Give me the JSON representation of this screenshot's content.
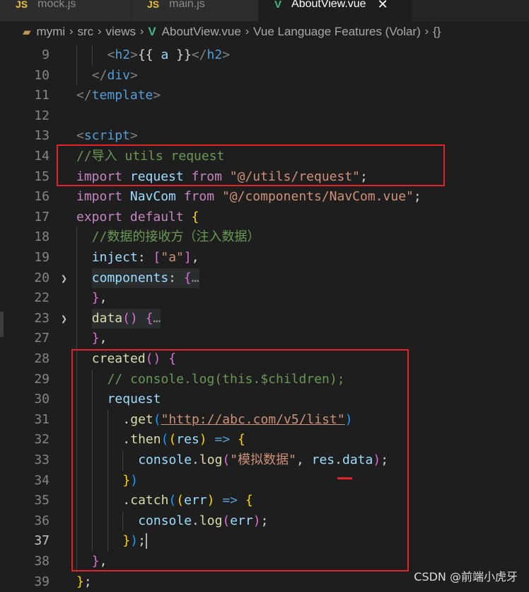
{
  "tabs": [
    {
      "icon": "JS",
      "label": "mock.js",
      "active": false
    },
    {
      "icon": "JS",
      "label": "main.js",
      "active": false
    },
    {
      "icon": "V",
      "label": "AboutView.vue",
      "active": true,
      "close": "✕"
    }
  ],
  "breadcrumb": {
    "items": [
      "mymi",
      "src",
      "views",
      "AboutView.vue",
      "Vue Language Features (Volar)",
      "{}"
    ],
    "sep": "›"
  },
  "lines": [
    {
      "n": "9",
      "tokens": [
        [
          "tag-pun",
          "<"
        ],
        [
          "tag",
          "h2"
        ],
        [
          "tag-pun",
          ">"
        ],
        [
          "text",
          "{{ "
        ],
        [
          "prop",
          "a"
        ],
        [
          "text",
          " }}"
        ],
        [
          "tag-pun",
          "</"
        ],
        [
          "tag",
          "h2"
        ],
        [
          "tag-pun",
          ">"
        ]
      ]
    },
    {
      "n": "10",
      "tokens": [
        [
          "tag-pun",
          "</"
        ],
        [
          "tag",
          "div"
        ],
        [
          "tag-pun",
          ">"
        ]
      ]
    },
    {
      "n": "11",
      "tokens": [
        [
          "tag-pun",
          "</"
        ],
        [
          "tag",
          "template"
        ],
        [
          "tag-pun",
          ">"
        ]
      ]
    },
    {
      "n": "12",
      "tokens": []
    },
    {
      "n": "13",
      "tokens": [
        [
          "tag-pun",
          "<"
        ],
        [
          "tag",
          "script"
        ],
        [
          "tag-pun",
          ">"
        ]
      ]
    },
    {
      "n": "14",
      "tokens": [
        [
          "cmt",
          "//导入 utils request"
        ]
      ]
    },
    {
      "n": "15",
      "tokens": [
        [
          "kw",
          "import"
        ],
        [
          "text",
          " "
        ],
        [
          "prop",
          "request"
        ],
        [
          "text",
          " "
        ],
        [
          "kw",
          "from"
        ],
        [
          "text",
          " "
        ],
        [
          "str",
          "\"@/utils/request\""
        ],
        [
          "text",
          ";"
        ]
      ]
    },
    {
      "n": "16",
      "tokens": [
        [
          "kw",
          "import"
        ],
        [
          "text",
          " "
        ],
        [
          "prop",
          "NavCom"
        ],
        [
          "text",
          " "
        ],
        [
          "kw",
          "from"
        ],
        [
          "text",
          " "
        ],
        [
          "str",
          "\"@/components/NavCom.vue\""
        ],
        [
          "text",
          ";"
        ]
      ]
    },
    {
      "n": "17",
      "tokens": [
        [
          "kw",
          "export"
        ],
        [
          "text",
          " "
        ],
        [
          "kw",
          "default"
        ],
        [
          "text",
          " "
        ],
        [
          "br1",
          "{"
        ]
      ]
    },
    {
      "n": "18",
      "tokens": [
        [
          "cmt",
          "//数据的接收方（注入数据）"
        ]
      ]
    },
    {
      "n": "19",
      "tokens": [
        [
          "prop",
          "inject"
        ],
        [
          "text",
          ": "
        ],
        [
          "br2",
          "["
        ],
        [
          "str",
          "\"a\""
        ],
        [
          "br2",
          "]"
        ],
        [
          "text",
          ","
        ]
      ]
    },
    {
      "n": "20",
      "tokens": [
        [
          "prop",
          "components"
        ],
        [
          "text",
          ": "
        ],
        [
          "br2",
          "{"
        ],
        [
          "ell",
          "…"
        ]
      ]
    },
    {
      "n": "22",
      "tokens": [
        [
          "br2",
          "}"
        ],
        [
          "text",
          ","
        ]
      ]
    },
    {
      "n": "23",
      "tokens": [
        [
          "fn",
          "data"
        ],
        [
          "br2",
          "()"
        ],
        [
          "text",
          " "
        ],
        [
          "br2",
          "{"
        ],
        [
          "ell",
          "…"
        ]
      ]
    },
    {
      "n": "27",
      "tokens": [
        [
          "br2",
          "}"
        ],
        [
          "text",
          ","
        ]
      ]
    },
    {
      "n": "28",
      "tokens": [
        [
          "fn",
          "created"
        ],
        [
          "br2",
          "()"
        ],
        [
          "text",
          " "
        ],
        [
          "br2",
          "{"
        ]
      ]
    },
    {
      "n": "29",
      "tokens": [
        [
          "cmt",
          "// console.log(this.$children);"
        ]
      ]
    },
    {
      "n": "30",
      "tokens": [
        [
          "prop",
          "request"
        ]
      ]
    },
    {
      "n": "31",
      "tokens": [
        [
          "text",
          "."
        ],
        [
          "fn",
          "get"
        ],
        [
          "br3",
          "("
        ],
        [
          "str-ul",
          "\"http://abc.com/v5/list\""
        ],
        [
          "br3",
          ")"
        ]
      ]
    },
    {
      "n": "32",
      "tokens": [
        [
          "text",
          "."
        ],
        [
          "fn",
          "then"
        ],
        [
          "br3",
          "("
        ],
        [
          "br1",
          "("
        ],
        [
          "prop",
          "res"
        ],
        [
          "br1",
          ")"
        ],
        [
          "text",
          " "
        ],
        [
          "tag",
          "=>"
        ],
        [
          "text",
          " "
        ],
        [
          "br1",
          "{"
        ]
      ]
    },
    {
      "n": "33",
      "tokens": [
        [
          "prop",
          "console"
        ],
        [
          "text",
          "."
        ],
        [
          "fn",
          "log"
        ],
        [
          "br2",
          "("
        ],
        [
          "str",
          "\"模拟数据\""
        ],
        [
          "text",
          ", "
        ],
        [
          "prop",
          "res"
        ],
        [
          "text",
          "."
        ],
        [
          "prop",
          "data"
        ],
        [
          "br2",
          ")"
        ],
        [
          "text",
          ";"
        ]
      ]
    },
    {
      "n": "34",
      "tokens": [
        [
          "br1",
          "}"
        ],
        [
          "br3",
          ")"
        ]
      ]
    },
    {
      "n": "35",
      "tokens": [
        [
          "text",
          "."
        ],
        [
          "fn",
          "catch"
        ],
        [
          "br3",
          "("
        ],
        [
          "br1",
          "("
        ],
        [
          "prop",
          "err"
        ],
        [
          "br1",
          ")"
        ],
        [
          "text",
          " "
        ],
        [
          "tag",
          "=>"
        ],
        [
          "text",
          " "
        ],
        [
          "br1",
          "{"
        ]
      ]
    },
    {
      "n": "36",
      "tokens": [
        [
          "prop",
          "console"
        ],
        [
          "text",
          "."
        ],
        [
          "fn",
          "log"
        ],
        [
          "br2",
          "("
        ],
        [
          "prop",
          "err"
        ],
        [
          "br2",
          ")"
        ],
        [
          "text",
          ";"
        ]
      ]
    },
    {
      "n": "37",
      "tokens": [
        [
          "br1",
          "}"
        ],
        [
          "br3",
          ")"
        ],
        [
          "text",
          ";"
        ]
      ]
    },
    {
      "n": "38",
      "tokens": [
        [
          "br2",
          "}"
        ],
        [
          "text",
          ","
        ]
      ]
    },
    {
      "n": "39",
      "tokens": [
        [
          "br1",
          "}"
        ],
        [
          "text",
          ";"
        ]
      ]
    }
  ],
  "watermark": "CSDN @前端小虎牙"
}
